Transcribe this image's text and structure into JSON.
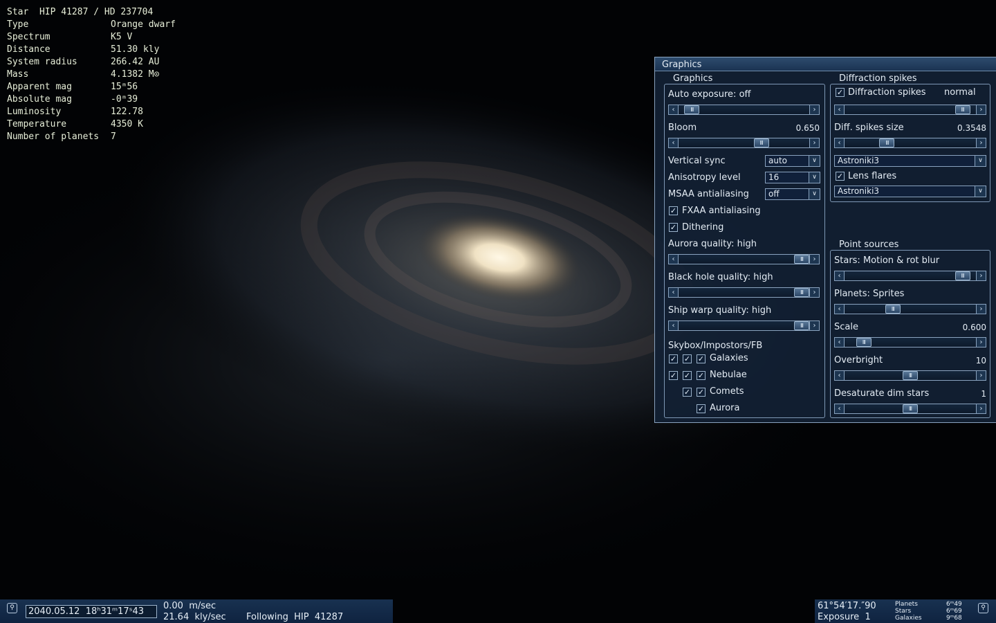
{
  "star_info": {
    "title": "Star  HIP 41287 / HD 237704",
    "rows": [
      {
        "key": "Type",
        "value": "Orange dwarf"
      },
      {
        "key": "Spectrum",
        "value": "K5 V"
      },
      {
        "key": "Distance",
        "value": "51.30 kly"
      },
      {
        "key": "System radius",
        "value": "266.42 AU"
      },
      {
        "key": "Mass",
        "value": "4.1382 M⊙"
      },
      {
        "key": "Apparent mag",
        "value": "15ᵐ56"
      },
      {
        "key": "Absolute mag",
        "value": "-0ᵐ39"
      },
      {
        "key": "Luminosity",
        "value": "122.78"
      },
      {
        "key": "Temperature",
        "value": "4350 K"
      },
      {
        "key": "Number of planets",
        "value": "7"
      }
    ]
  },
  "graphics_window": {
    "title": "Graphics",
    "graphics_group": {
      "label": "Graphics",
      "auto_exposure": {
        "label": "Auto exposure: off",
        "level": 0.05
      },
      "bloom": {
        "label": "Bloom",
        "value": "0.650",
        "level": 0.65
      },
      "vertical_sync": {
        "label": "Vertical sync",
        "value": "auto"
      },
      "anisotropy": {
        "label": "Anisotropy level",
        "value": "16"
      },
      "msaa": {
        "label": "MSAA antialiasing",
        "value": "off"
      },
      "fxaa": {
        "label": "FXAA antialiasing",
        "checked": true
      },
      "dithering": {
        "label": "Dithering",
        "checked": true
      },
      "aurora_quality": {
        "label": "Aurora quality: high",
        "level": 1.0
      },
      "black_hole_quality": {
        "label": "Black hole quality: high",
        "level": 1.0
      },
      "ship_warp_quality": {
        "label": "Ship warp quality: high",
        "level": 1.0
      },
      "skybox": {
        "label": "Skybox/Impostors/FB",
        "items": [
          {
            "label": "Galaxies",
            "checks": [
              true,
              true,
              true
            ]
          },
          {
            "label": "Nebulae",
            "checks": [
              true,
              true,
              true
            ]
          },
          {
            "label": "Comets",
            "checks": [
              true,
              true
            ]
          },
          {
            "label": "Aurora",
            "checks": [
              true
            ]
          }
        ]
      }
    },
    "diffraction_group": {
      "label": "Diffraction spikes",
      "spikes": {
        "label": "Diffraction spikes",
        "mode": "normal",
        "checked": true,
        "level": 0.95
      },
      "spikes_size": {
        "label": "Diff. spikes size",
        "value": "0.3548",
        "level": 0.3
      },
      "spikes_texture": {
        "value": "Astroniki3"
      },
      "lens_flares": {
        "label": "Lens flares",
        "checked": true
      },
      "flares_texture": {
        "value": "Astroniki3"
      }
    },
    "point_sources_group": {
      "label": "Point sources",
      "stars": {
        "label": "Stars: Motion & rot blur",
        "level": 0.95
      },
      "planets": {
        "label": "Planets: Sprites",
        "level": 0.35
      },
      "scale": {
        "label": "Scale",
        "value": "0.600",
        "level": 0.1
      },
      "overbright": {
        "label": "Overbright",
        "value": "10",
        "level": 0.5
      },
      "desaturate": {
        "label": "Desaturate dim stars",
        "value": "1",
        "level": 0.5
      }
    }
  },
  "status_left": {
    "datetime": "2040.05.12  18ʰ31ᵐ17ˢ43",
    "speed": "0.00  m/sec",
    "speed2": "21.64  kly/sec",
    "following": "Following  HIP  41287"
  },
  "status_right": {
    "fov": "61°54′17.″90",
    "exposure": "Exposure  1",
    "lim_labels": [
      "Planets",
      "Stars",
      "Galaxies"
    ],
    "lim_values": [
      "6ᵐ49",
      "6ᵐ69",
      "9ᵐ68"
    ]
  },
  "icons": {
    "status_left_icon": "pin-icon",
    "status_right_icon": "pin-icon"
  }
}
